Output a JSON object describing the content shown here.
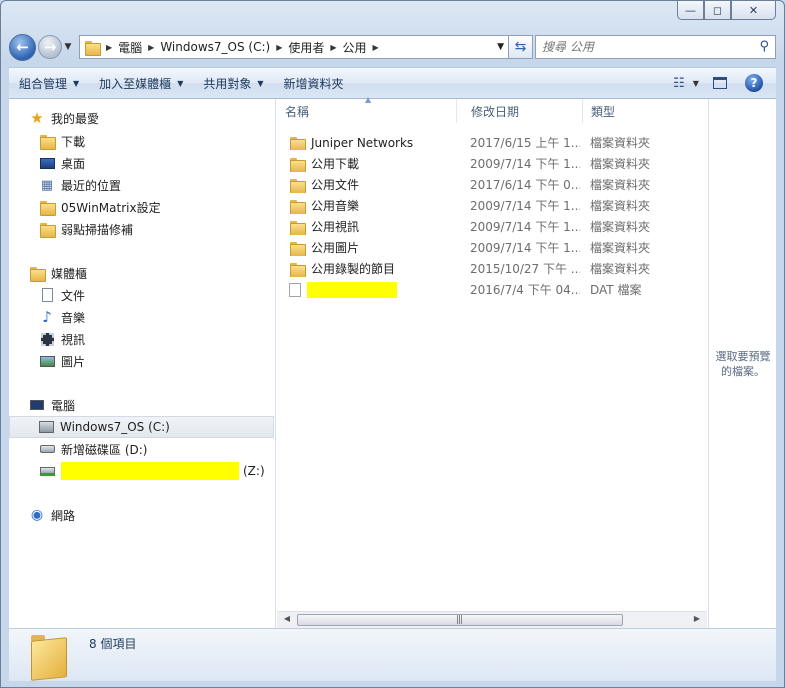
{
  "window": {
    "controls": {
      "minimize": "—",
      "maximize": "◻",
      "close": "✕"
    }
  },
  "address": {
    "segments": [
      "電腦",
      "Windows7_OS (C:)",
      "使用者",
      "公用"
    ]
  },
  "search": {
    "placeholder": "搜尋 公用"
  },
  "toolbar": {
    "organize": "組合管理",
    "include_in_library": "加入至媒體櫃",
    "share_with": "共用對象",
    "new_folder": "新增資料夾"
  },
  "nav": {
    "favorites": {
      "label": "我的最愛",
      "items": [
        "下載",
        "桌面",
        "最近的位置",
        "05WinMatrix設定",
        "弱點掃描修補"
      ]
    },
    "libraries": {
      "label": "媒體櫃",
      "items": [
        "文件",
        "音樂",
        "視訊",
        "圖片"
      ]
    },
    "computer": {
      "label": "電腦",
      "items": [
        "Windows7_OS (C:)",
        "新增磁碟區 (D:)",
        "(Z:)"
      ]
    },
    "network": {
      "label": "網路"
    }
  },
  "columns": {
    "name": "名稱",
    "date": "修改日期",
    "type": "類型"
  },
  "files": [
    {
      "name": "Juniper Networks",
      "date": "2017/6/15 上午 1...",
      "type": "檔案資料夾",
      "kind": "folder"
    },
    {
      "name": "公用下載",
      "date": "2009/7/14 下午 1...",
      "type": "檔案資料夾",
      "kind": "folder"
    },
    {
      "name": "公用文件",
      "date": "2017/6/14 下午 0...",
      "type": "檔案資料夾",
      "kind": "folder"
    },
    {
      "name": "公用音樂",
      "date": "2009/7/14 下午 1...",
      "type": "檔案資料夾",
      "kind": "folder"
    },
    {
      "name": "公用視訊",
      "date": "2009/7/14 下午 1...",
      "type": "檔案資料夾",
      "kind": "folder"
    },
    {
      "name": "公用圖片",
      "date": "2009/7/14 下午 1...",
      "type": "檔案資料夾",
      "kind": "folder"
    },
    {
      "name": "公用錄製的節目",
      "date": "2015/10/27 下午 ...",
      "type": "檔案資料夾",
      "kind": "folder"
    },
    {
      "name": "",
      "date": "2016/7/4 下午 04...",
      "type": "DAT 檔案",
      "kind": "file"
    }
  ],
  "preview": {
    "line1": "選取要預覽",
    "line2": "的檔案。"
  },
  "status": {
    "item_count": "8 個項目"
  },
  "colors": {
    "accent": "#2e64b5",
    "highlight": "#ffff00",
    "folder": "#e6b54a"
  }
}
